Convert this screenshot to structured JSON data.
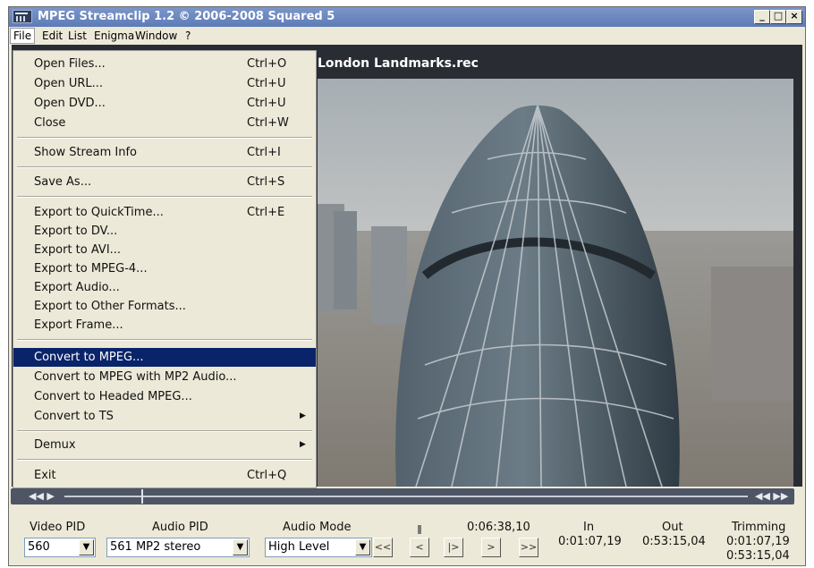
{
  "window": {
    "title": "MPEG Streamclip 1.2  ©  2006-2008 Squared 5"
  },
  "window_controls": {
    "minimize": "_",
    "maximize": "□",
    "close": "×"
  },
  "menubar": [
    "File",
    "Edit",
    "List",
    "Enigma",
    "Window",
    "?"
  ],
  "file_menu": {
    "items": [
      {
        "label": "Open Files...",
        "shortcut": "Ctrl+O"
      },
      {
        "label": "Open URL...",
        "shortcut": "Ctrl+U"
      },
      {
        "label": "Open DVD...",
        "shortcut": "Ctrl+U"
      },
      {
        "label": "Close",
        "shortcut": "Ctrl+W"
      },
      {
        "label": "Show Stream Info",
        "shortcut": "Ctrl+I"
      },
      {
        "label": "Save As...",
        "shortcut": "Ctrl+S"
      },
      {
        "label": "Export to QuickTime...",
        "shortcut": "Ctrl+E"
      },
      {
        "label": "Export to DV...",
        "shortcut": ""
      },
      {
        "label": "Export to AVI...",
        "shortcut": ""
      },
      {
        "label": "Export to MPEG-4...",
        "shortcut": ""
      },
      {
        "label": "Export Audio...",
        "shortcut": ""
      },
      {
        "label": "Export to Other Formats...",
        "shortcut": ""
      },
      {
        "label": "Export Frame...",
        "shortcut": ""
      },
      {
        "label": "Convert to MPEG...",
        "shortcut": "",
        "highlighted": true
      },
      {
        "label": "Convert to MPEG with MP2 Audio...",
        "shortcut": ""
      },
      {
        "label": "Convert to Headed MPEG...",
        "shortcut": ""
      },
      {
        "label": "Convert to TS",
        "shortcut": "",
        "submenu": true
      },
      {
        "label": "Demux",
        "shortcut": "",
        "submenu": true
      },
      {
        "label": "Exit",
        "shortcut": "Ctrl+Q"
      }
    ],
    "submenu_arrow": "▶"
  },
  "video": {
    "filename": "London Landmarks.rec",
    "description": "Aerial view of the 30 St Mary Axe (Gherkin) tower in London"
  },
  "scrubber": {
    "left_controls": "◀◀ ▶",
    "right_controls": "◀◀ ▶▶"
  },
  "bottom": {
    "video_pid_label": "Video PID",
    "audio_pid_label": "Audio PID",
    "audio_mode_label": "Audio Mode",
    "video_pid_value": "560",
    "audio_pid_value": "561 MP2 stereo",
    "audio_mode_value": "High Level",
    "current_time": "0:06:38,10",
    "in_label": "In",
    "in_value": "0:01:07,19",
    "out_label": "Out",
    "out_value": "0:53:15,04",
    "trimming_label": "Trimming",
    "trimming_in": "0:01:07,19",
    "trimming_out": "0:53:15,04",
    "buttons": [
      "<<",
      "<",
      "|>",
      ">",
      ">>"
    ],
    "dropdown_arrow": "▼"
  }
}
